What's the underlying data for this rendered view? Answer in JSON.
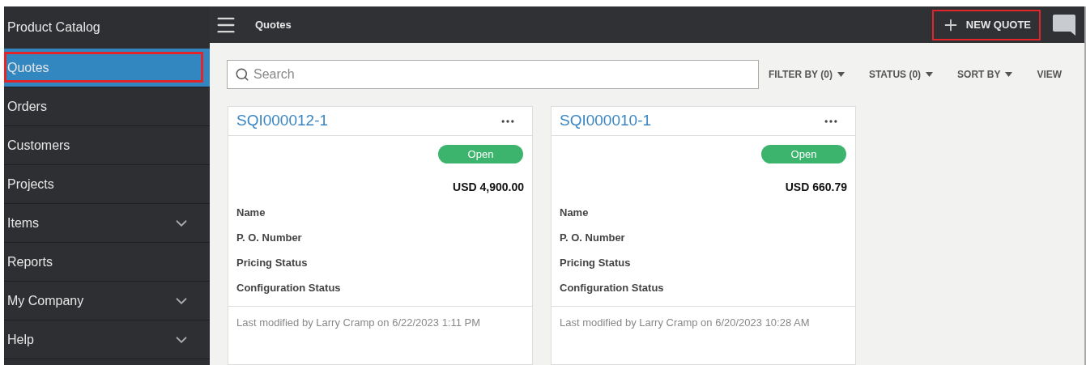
{
  "sidebar": {
    "title": "Product Catalog",
    "items": [
      {
        "label": "Quotes",
        "selected": true,
        "expandable": false,
        "annotated": true
      },
      {
        "label": "Orders",
        "selected": false,
        "expandable": false,
        "annotated": false
      },
      {
        "label": "Customers",
        "selected": false,
        "expandable": false,
        "annotated": false
      },
      {
        "label": "Projects",
        "selected": false,
        "expandable": false,
        "annotated": false
      },
      {
        "label": "Items",
        "selected": false,
        "expandable": true,
        "annotated": false
      },
      {
        "label": "Reports",
        "selected": false,
        "expandable": false,
        "annotated": false
      },
      {
        "label": "My Company",
        "selected": false,
        "expandable": true,
        "annotated": false
      },
      {
        "label": "Help",
        "selected": false,
        "expandable": true,
        "annotated": false
      }
    ]
  },
  "topbar": {
    "title": "Quotes",
    "new_button": {
      "label": "NEW QUOTE",
      "annotated": true
    }
  },
  "search": {
    "placeholder": "Search"
  },
  "toolbar": [
    {
      "label": "FILTER BY (0)",
      "caret": true
    },
    {
      "label": "STATUS (0)",
      "caret": true
    },
    {
      "label": "SORT BY",
      "caret": true
    },
    {
      "label": "VIEW",
      "caret": false
    }
  ],
  "cards": [
    {
      "id": "SQI000012-1",
      "status": "Open",
      "amount": "USD 4,900.00",
      "fields": [
        "Name",
        "P. O. Number",
        "Pricing Status",
        "Configuration Status"
      ],
      "footer": "Last modified by Larry Cramp on 6/22/2023 1:11 PM"
    },
    {
      "id": "SQI000010-1",
      "status": "Open",
      "amount": "USD 660.79",
      "fields": [
        "Name",
        "P. O. Number",
        "Pricing Status",
        "Configuration Status"
      ],
      "footer": "Last modified by Larry Cramp on 6/20/2023 10:28 AM"
    }
  ]
}
